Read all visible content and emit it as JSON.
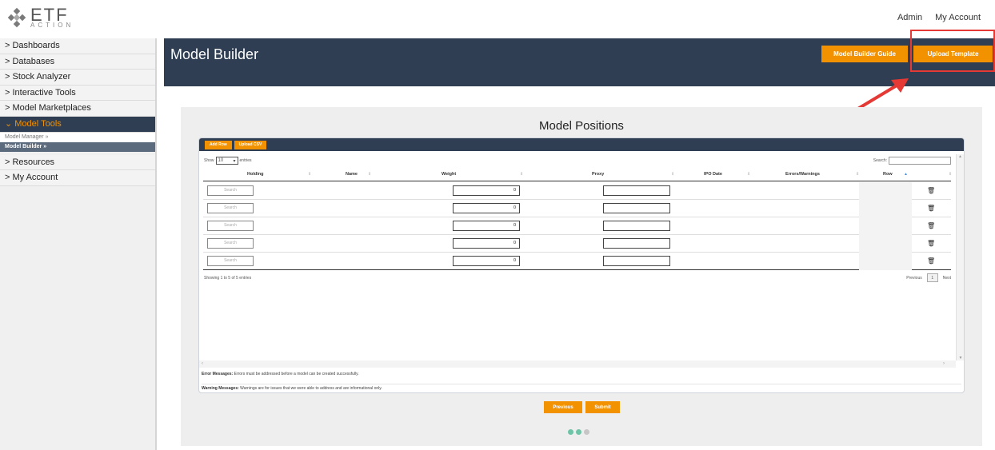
{
  "brand": {
    "logo_main": "ETF",
    "logo_sub": "ACTION"
  },
  "top_links": {
    "admin": "Admin",
    "account": "My Account"
  },
  "sidebar": {
    "items": [
      {
        "label": "> Dashboards"
      },
      {
        "label": "> Databases"
      },
      {
        "label": "> Stock Analyzer"
      },
      {
        "label": "> Interactive Tools"
      },
      {
        "label": "> Model Marketplaces"
      },
      {
        "label": "⌄ Model Tools"
      }
    ],
    "subitems": [
      {
        "label": "Model Manager »"
      },
      {
        "label": "Model Builder »"
      }
    ],
    "items_after": [
      {
        "label": "> Resources"
      },
      {
        "label": "> My Account"
      }
    ]
  },
  "header": {
    "title": "Model Builder",
    "guide_label": "Model Builder Guide",
    "upload_label": "Upload Template"
  },
  "card": {
    "title": "Model Positions"
  },
  "table": {
    "toolbar": {
      "add_row": "Add Row",
      "upload_csv": "Upload CSV"
    },
    "show_label": "Show",
    "page_size": "10",
    "entries_label": "entries",
    "search_label": "Search:",
    "columns": [
      "Holding",
      "Name",
      "Weight",
      "Proxy",
      "IPO Date",
      "Errors/Warnings",
      "Row"
    ],
    "rows": [
      {
        "search_placeholder": "Search",
        "weight": "0"
      },
      {
        "search_placeholder": "Search",
        "weight": "0"
      },
      {
        "search_placeholder": "Search",
        "weight": "0"
      },
      {
        "search_placeholder": "Search",
        "weight": "0"
      },
      {
        "search_placeholder": "Search",
        "weight": "0"
      }
    ],
    "info": "Showing 1 to 5 of 5 entries",
    "pager": {
      "previous": "Previous",
      "page": "1",
      "next": "Next"
    },
    "error_title": "Error Messages:",
    "error_text": "Errors must be addressed before a model can be created successfully.",
    "warning_title": "Warning Messages:",
    "warning_text": "Warnings are for issues that we were able to address and are informational only."
  },
  "footer_buttons": {
    "previous": "Previous",
    "submit": "Submit"
  },
  "colors": {
    "navy": "#2f3e52",
    "orange": "#f39200",
    "step_active": "#6ec4a7",
    "step_inactive": "#c6c6c6",
    "highlight": "#e53935"
  }
}
